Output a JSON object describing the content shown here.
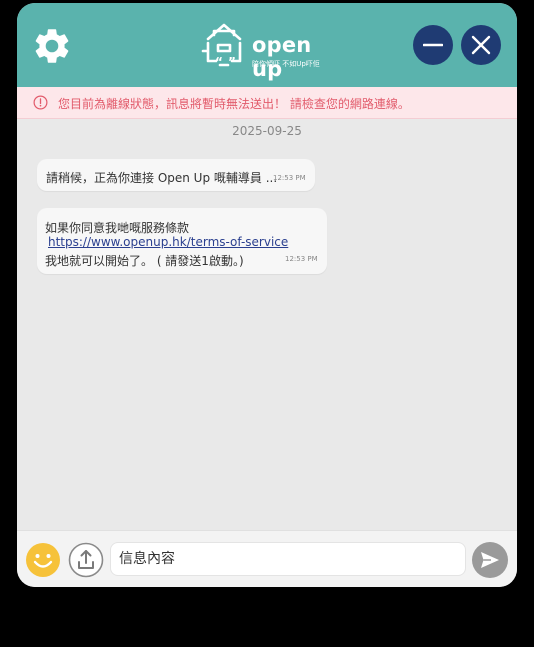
{
  "header": {
    "logo_text": "open up",
    "logo_subtitle": "陪你傾吓 不如Up吓佢",
    "bg_color": "#5ab3ad",
    "button_color": "#1f3b73",
    "icons": {
      "settings": "gear-icon",
      "minimize": "minus-icon",
      "close": "close-icon"
    }
  },
  "banner": {
    "text": "您目前為離線狀態，訊息將暫時無法送出！ 請檢查您的網路連線。",
    "bg_color": "#fde7ea",
    "text_color": "#e25b6b"
  },
  "chat": {
    "date": "2025-09-25",
    "messages": [
      {
        "text": "請稍候，正為你連接 Open Up 嘅輔導員 ...",
        "time": "12:53 PM"
      },
      {
        "line1": "如果你同意我哋嘅服務條款",
        "link": "https://www.openup.hk/terms-of-service",
        "line3": "我地就可以開始了。 ( 請發送1啟動。)",
        "time": "12:53 PM"
      }
    ]
  },
  "composer": {
    "placeholder": "信息內容",
    "icons": {
      "emoji": "smiley-icon",
      "upload": "upload-icon",
      "send": "send-icon"
    }
  }
}
